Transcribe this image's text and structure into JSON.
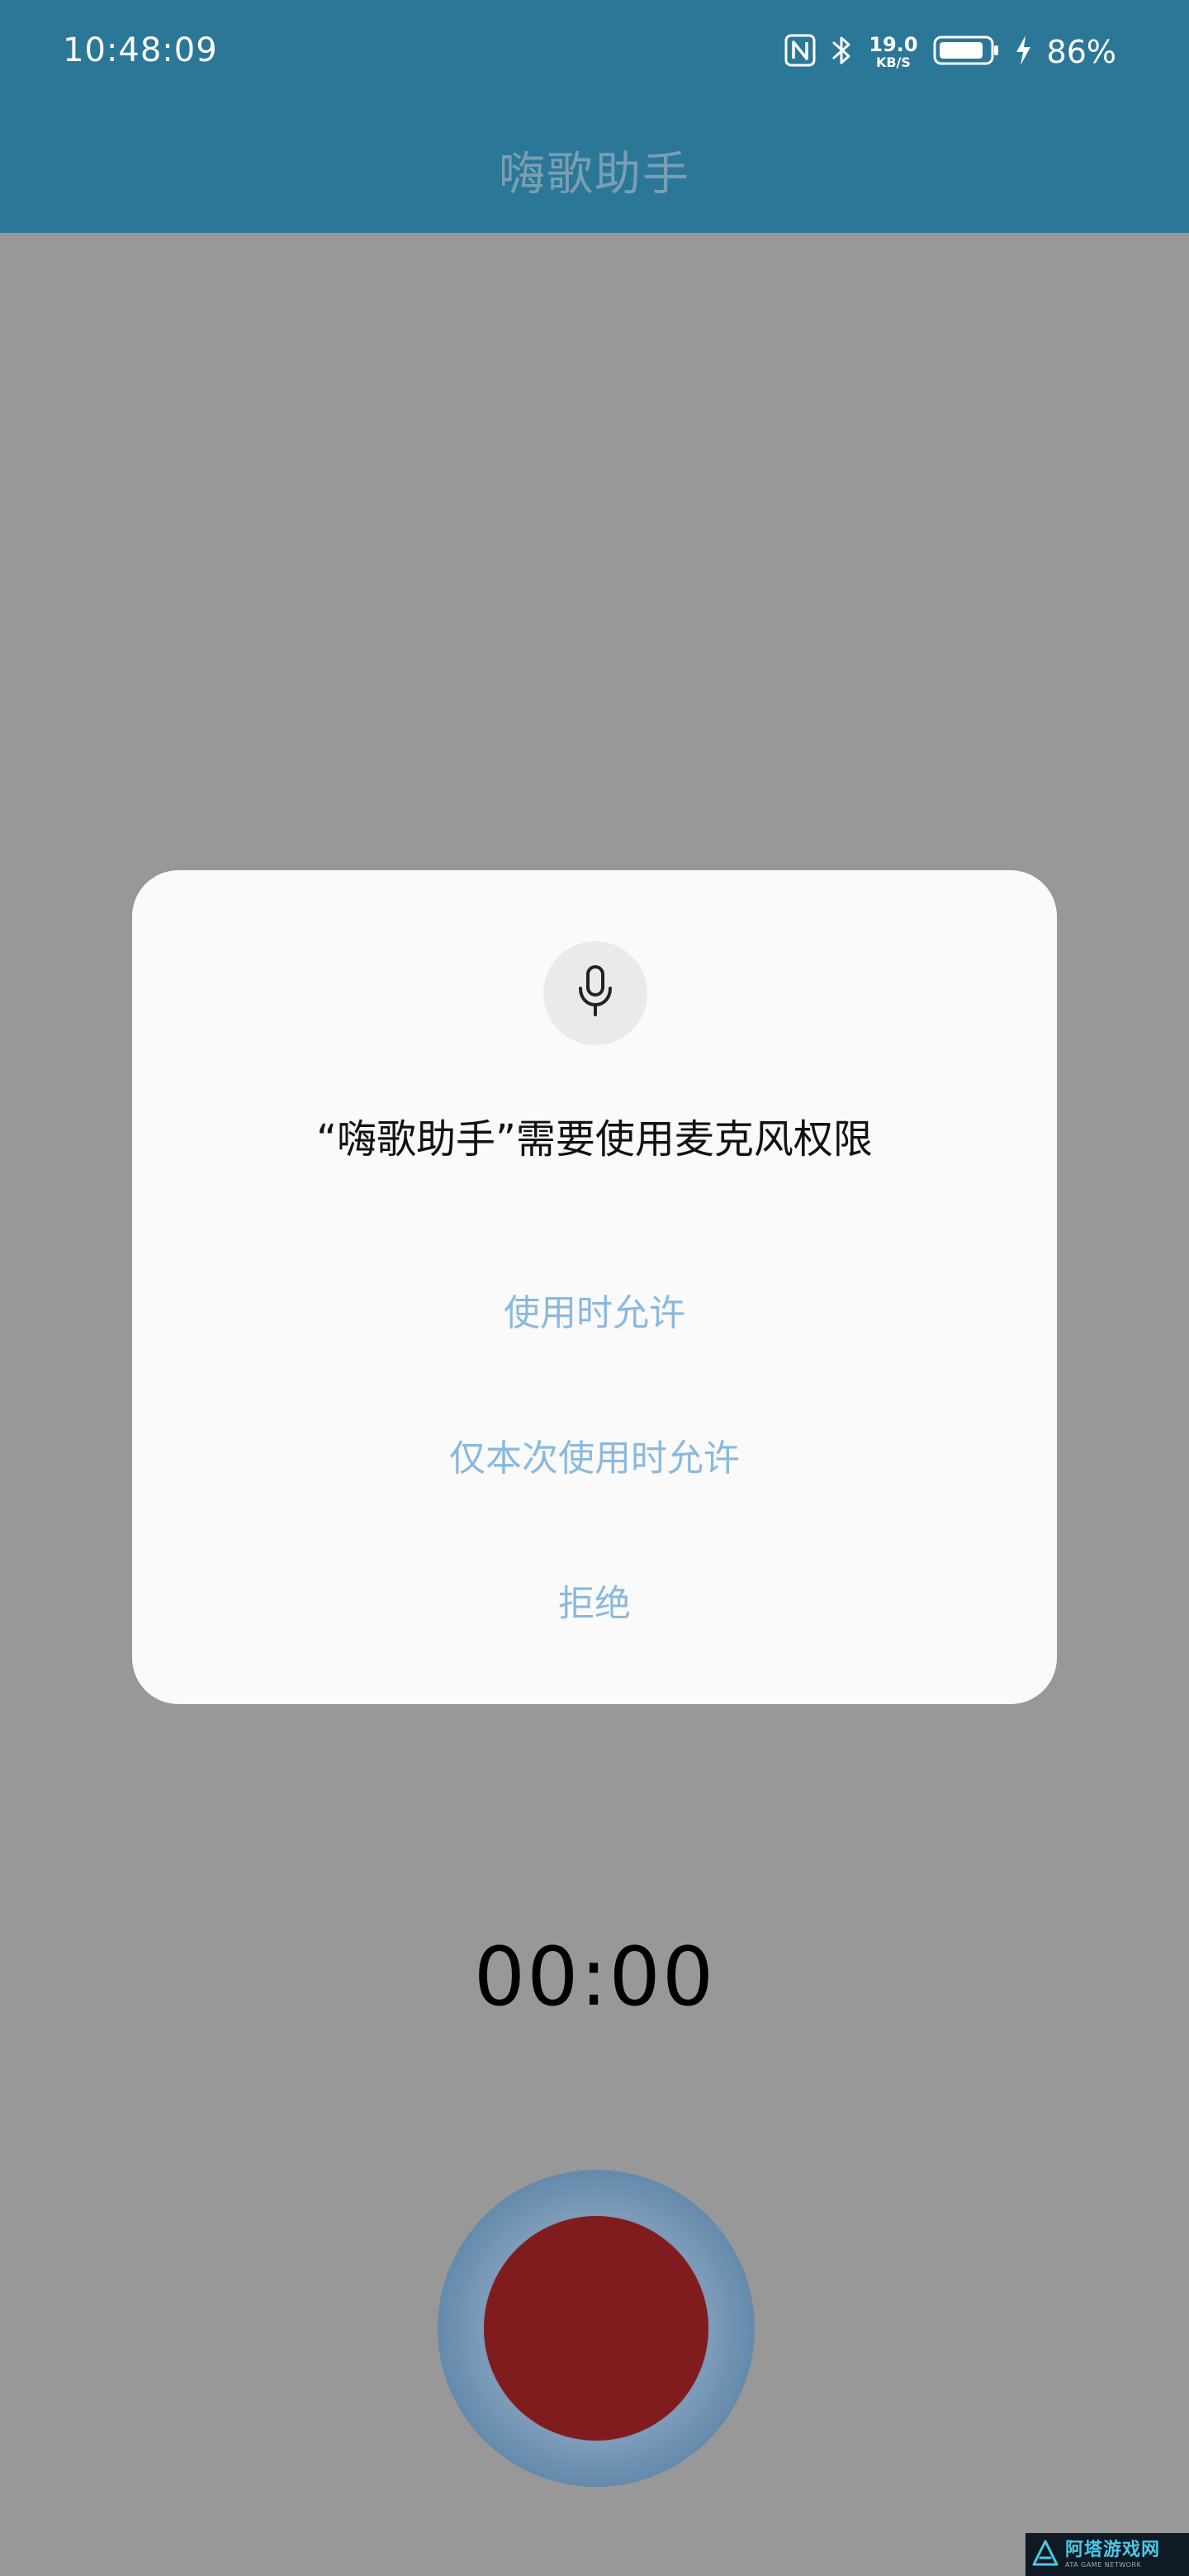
{
  "status_bar": {
    "time": "10:48:09",
    "net_speed_value": "19.0",
    "net_speed_unit": "KB/S",
    "battery_percent": "86%",
    "icons": [
      "nfc-icon",
      "bluetooth-icon",
      "battery-icon",
      "charging-bolt-icon"
    ]
  },
  "app_bar": {
    "title": "嗨歌助手"
  },
  "permission_dialog": {
    "icon": "microphone-icon",
    "title": "“嗨歌助手”需要使用麦克风权限",
    "options": [
      {
        "label": "使用时允许"
      },
      {
        "label": "仅本次使用时允许"
      },
      {
        "label": "拒绝"
      }
    ]
  },
  "recorder": {
    "timer": "00:00"
  },
  "watermark": {
    "main": "阿塔游戏网",
    "sub": "ATA GAME NETWORK"
  },
  "colors": {
    "app_bar": "#2b7798",
    "scrim_background": "#989898",
    "option_text": "#8ab9de",
    "record_button": "#801c1e",
    "record_ring": "#7f9dbb"
  }
}
